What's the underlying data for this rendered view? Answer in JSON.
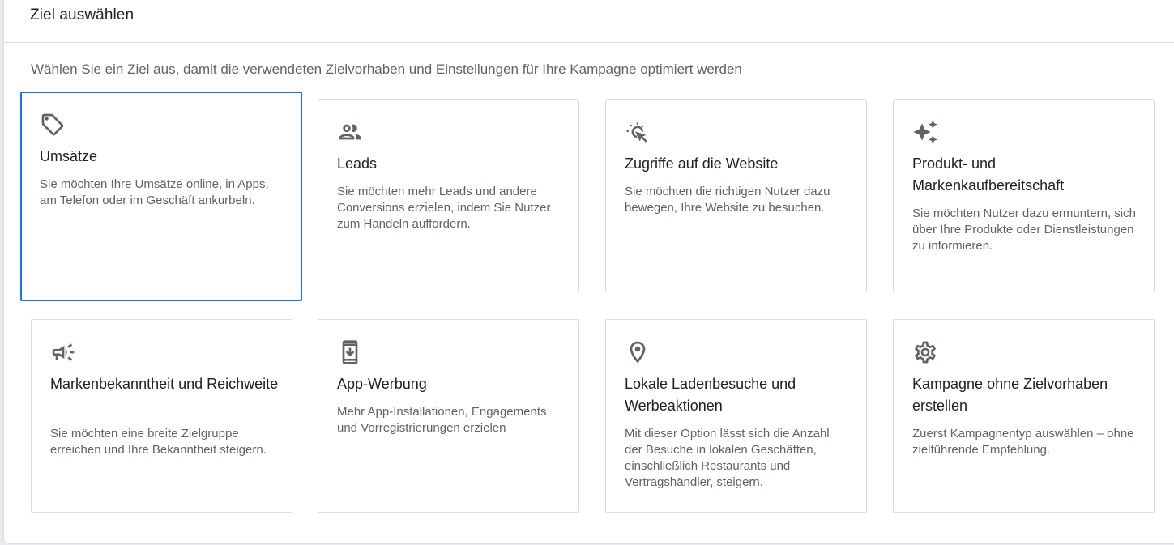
{
  "dialog": {
    "title": "Ziel auswählen",
    "subtitle": "Wählen Sie ein Ziel aus, damit die verwendeten Zielvorhaben und Einstellungen für Ihre Kampagne optimiert werden"
  },
  "accent_color": "#1a73e8",
  "selected_goal": "Umsätze",
  "goals": [
    {
      "icon": "tag-icon",
      "title": "Umsätze",
      "description": "Sie möchten Ihre Umsätze online, in Apps, am Telefon oder im Geschäft ankurbeln."
    },
    {
      "icon": "people-icon",
      "title": "Leads",
      "description": "Sie möchten mehr Leads und andere Conversions erzielen, indem Sie Nutzer zum Handeln auffordern."
    },
    {
      "icon": "cursor-click-icon",
      "title": "Zugriffe auf die Website",
      "description": "Sie möchten die richtigen Nutzer dazu bewegen, Ihre Website zu besuchen."
    },
    {
      "icon": "sparkle-icon",
      "title": "Produkt- und Markenkaufbereitschaft",
      "description": "Sie möchten Nutzer dazu ermuntern, sich über Ihre Produkte oder Dienstleistungen zu informieren."
    },
    {
      "icon": "megaphone-icon",
      "title": "Markenbekanntheit und Reichweite",
      "description": "Sie möchten eine breite Zielgruppe erreichen und Ihre Bekanntheit steigern."
    },
    {
      "icon": "phone-download-icon",
      "title": "App-Werbung",
      "description": "Mehr App-Installationen, Engagements und Vorregistrierungen erzielen"
    },
    {
      "icon": "location-pin-icon",
      "title": "Lokale Ladenbesuche und Werbeaktionen",
      "description": "Mit dieser Option lässt sich die Anzahl der Besuche in lokalen Geschäften, einschließlich Restaurants und Vertragshändler, steigern."
    },
    {
      "icon": "gear-icon",
      "title": "Kampagne ohne Zielvorhaben erstellen",
      "description": "Zuerst Kampagnentyp auswählen – ohne zielführende Empfehlung."
    }
  ]
}
